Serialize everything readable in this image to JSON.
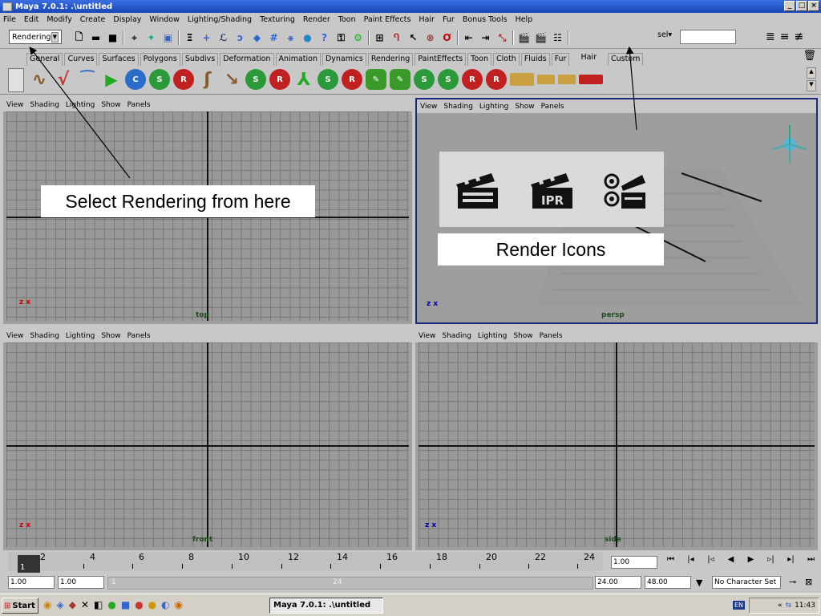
{
  "window": {
    "title": "Maya 7.0.1: .\\untitled",
    "controls": [
      "_",
      "□",
      "×"
    ]
  },
  "menus": [
    "File",
    "Edit",
    "Modify",
    "Create",
    "Display",
    "Window",
    "Lighting/Shading",
    "Texturing",
    "Render",
    "Toon",
    "Paint Effects",
    "Hair",
    "Fur",
    "Bonus Tools",
    "Help"
  ],
  "status": {
    "menu_set": "Rendering",
    "sel_label": "sel▾",
    "sel_value": ""
  },
  "shelf_tabs": [
    "General",
    "Curves",
    "Surfaces",
    "Polygons",
    "Subdivs",
    "Deformation",
    "Animation",
    "Dynamics",
    "Rendering",
    "PaintEffects",
    "Toon",
    "Cloth",
    "Fluids",
    "Fur",
    "Hair",
    "Custom"
  ],
  "shelf_active": "Hair",
  "viewport_menu": [
    "View",
    "Shading",
    "Lighting",
    "Show",
    "Panels"
  ],
  "viewports": {
    "top": "top",
    "persp": "persp",
    "front": "front",
    "side": "side"
  },
  "axes": {
    "top": "z x",
    "persp": "z x",
    "front": "z x",
    "side": "z x"
  },
  "timeline": {
    "ticks": [
      "1",
      "2",
      "4",
      "6",
      "8",
      "10",
      "12",
      "14",
      "16",
      "18",
      "20",
      "22",
      "24"
    ],
    "current": "1.00"
  },
  "range": {
    "start": "1.00",
    "start2": "1.00",
    "slider_start": "1",
    "slider_end": "24",
    "end": "24.00",
    "end2": "48.00",
    "character": "No Character Set"
  },
  "taskbar": {
    "start": "Start",
    "task": "Maya 7.0.1: .\\untitled",
    "lang": "EN",
    "time": "11:43"
  },
  "annotations": {
    "select_rendering": "Select Rendering from here",
    "render_icons": "Render Icons",
    "icon_labels": [
      "",
      "IPR",
      ""
    ]
  },
  "colors": {
    "titlebar": "#1846b8",
    "viewport_bg": "#9e9e9e",
    "active_border": "#1b2a7a"
  }
}
